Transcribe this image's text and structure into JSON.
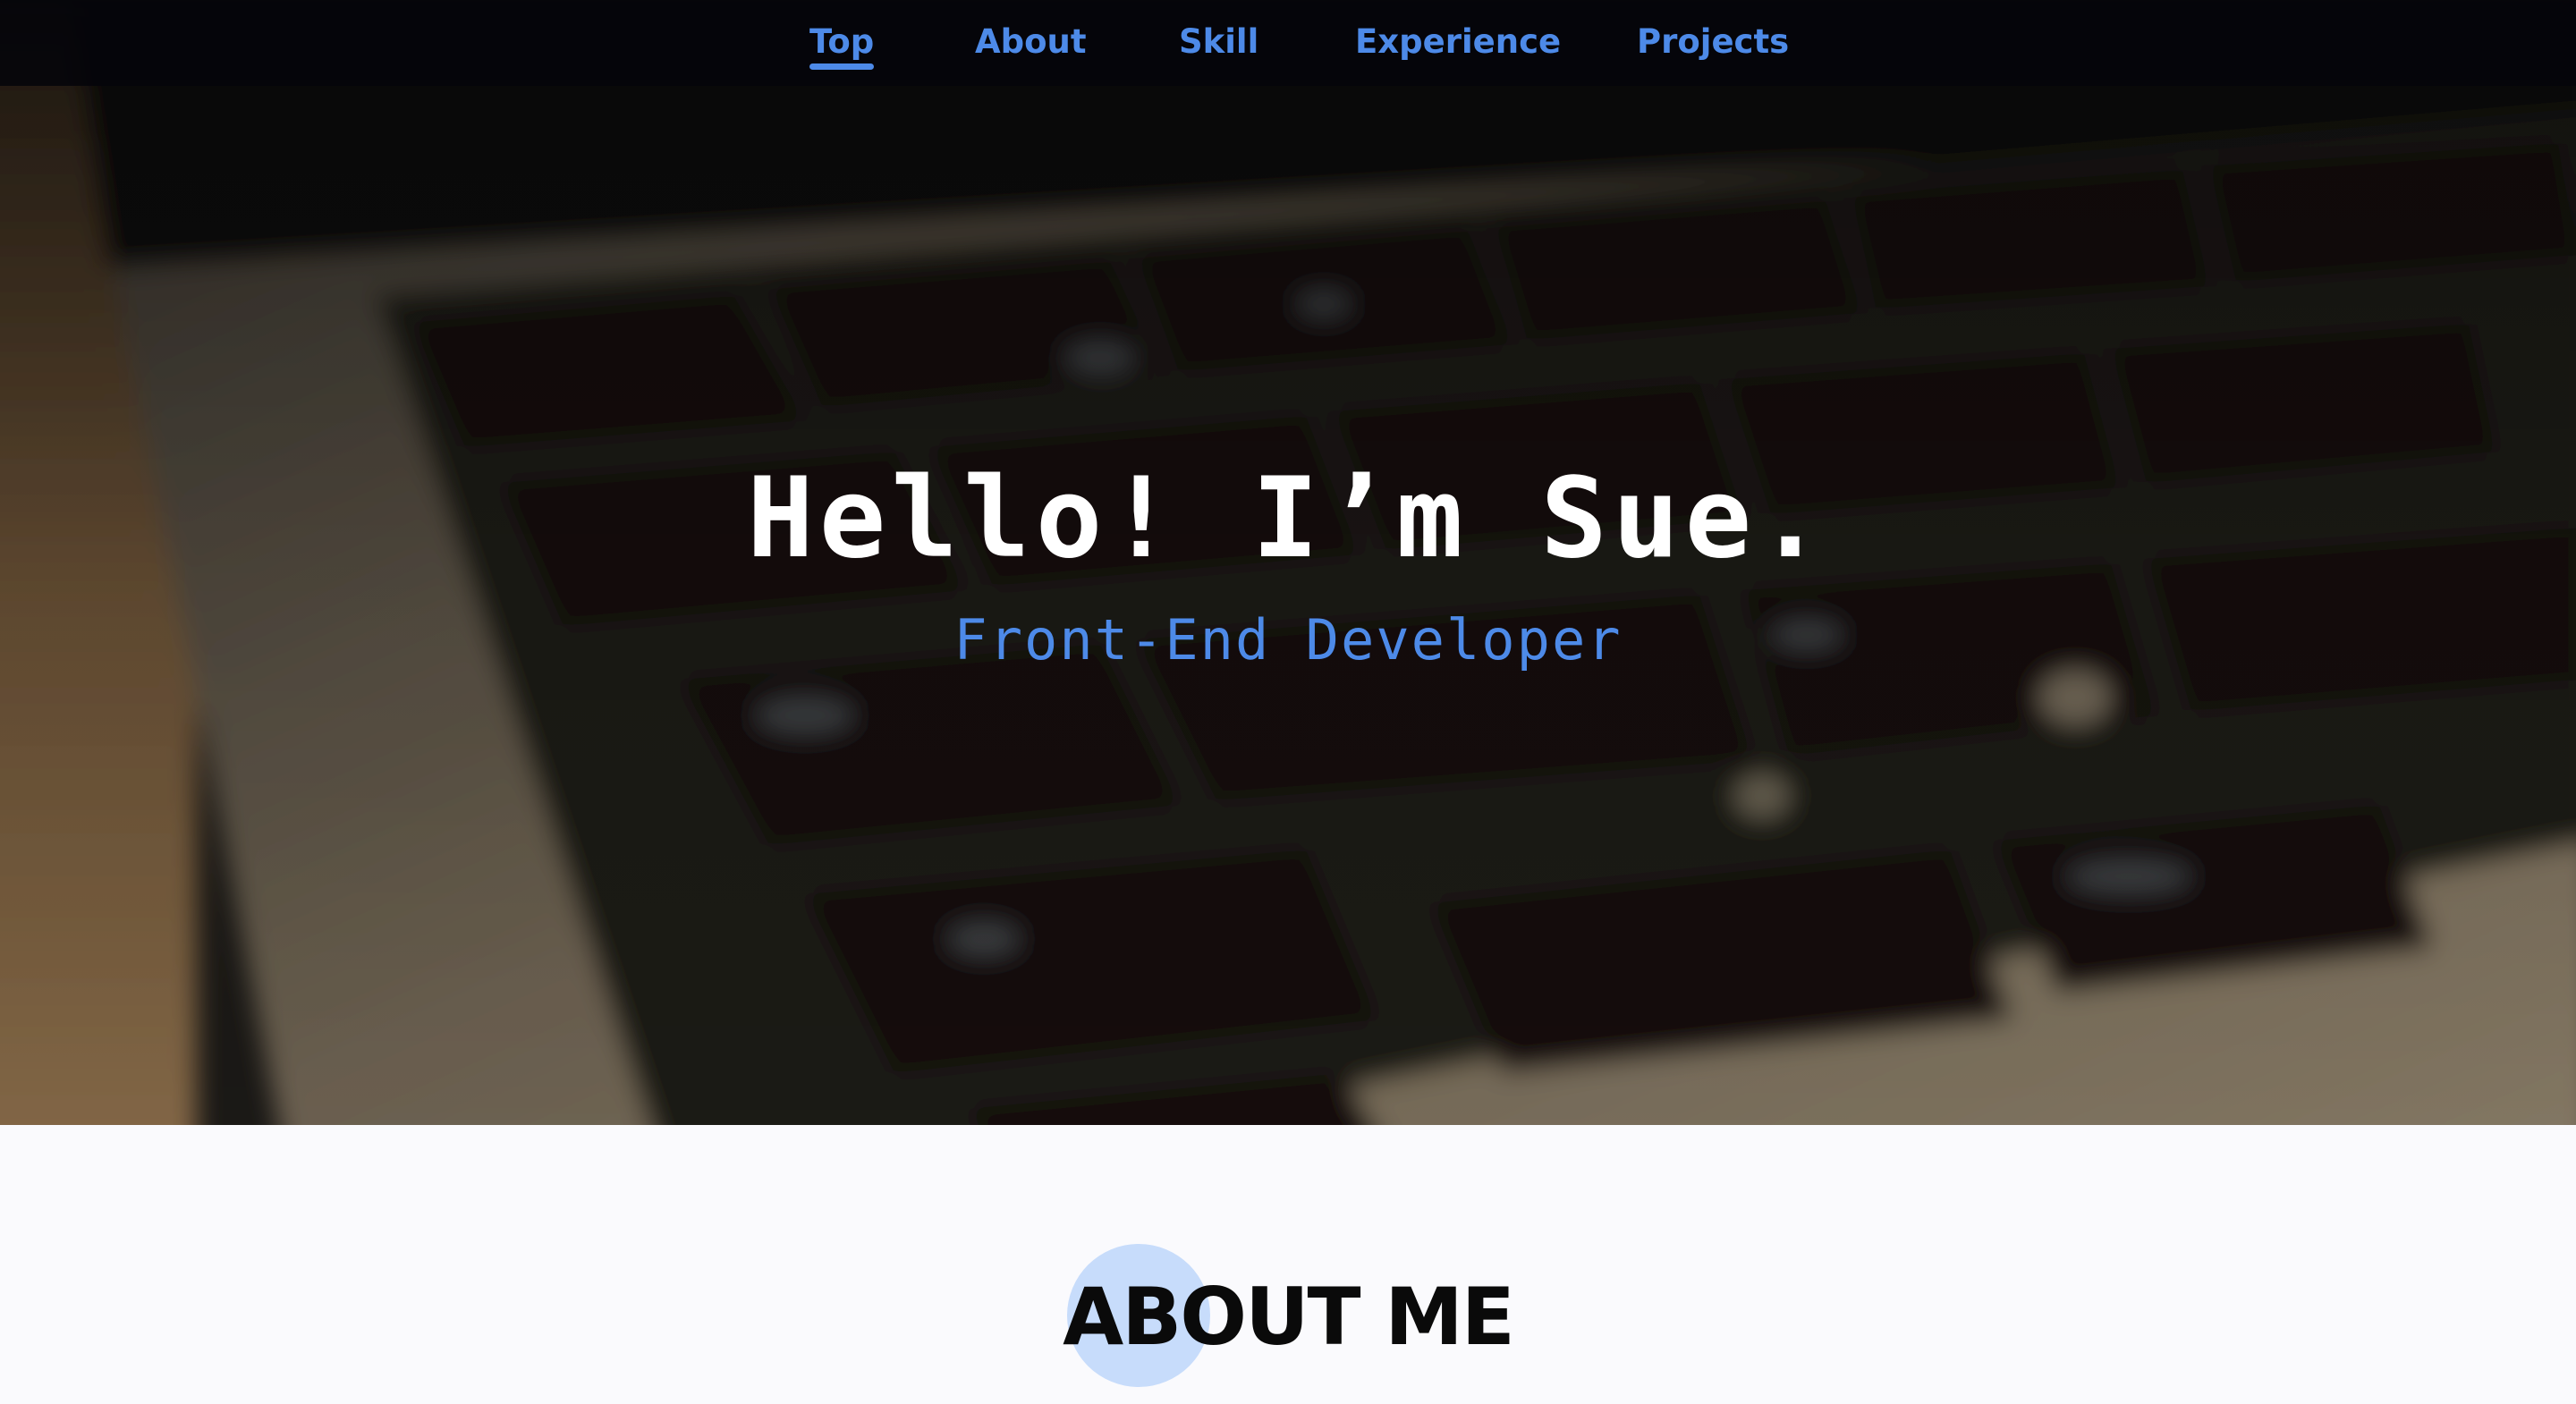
{
  "nav": {
    "items": [
      {
        "label": "Top",
        "active": true
      },
      {
        "label": "About",
        "active": false
      },
      {
        "label": "Skill",
        "active": false
      },
      {
        "label": "Experience",
        "active": false
      },
      {
        "label": "Projects",
        "active": false
      }
    ]
  },
  "hero": {
    "title": "Hello! I’m Sue.",
    "subtitle": "Front-End Developer",
    "background": "blurred-laptop-keyboard-photo"
  },
  "about": {
    "title": "ABOUT ME"
  },
  "colors": {
    "accent": "#4d8ae8",
    "nav_background": "#05050a",
    "about_background": "#fafafd",
    "about_circle": "#c7dcfb",
    "hero_title": "#ffffff"
  }
}
